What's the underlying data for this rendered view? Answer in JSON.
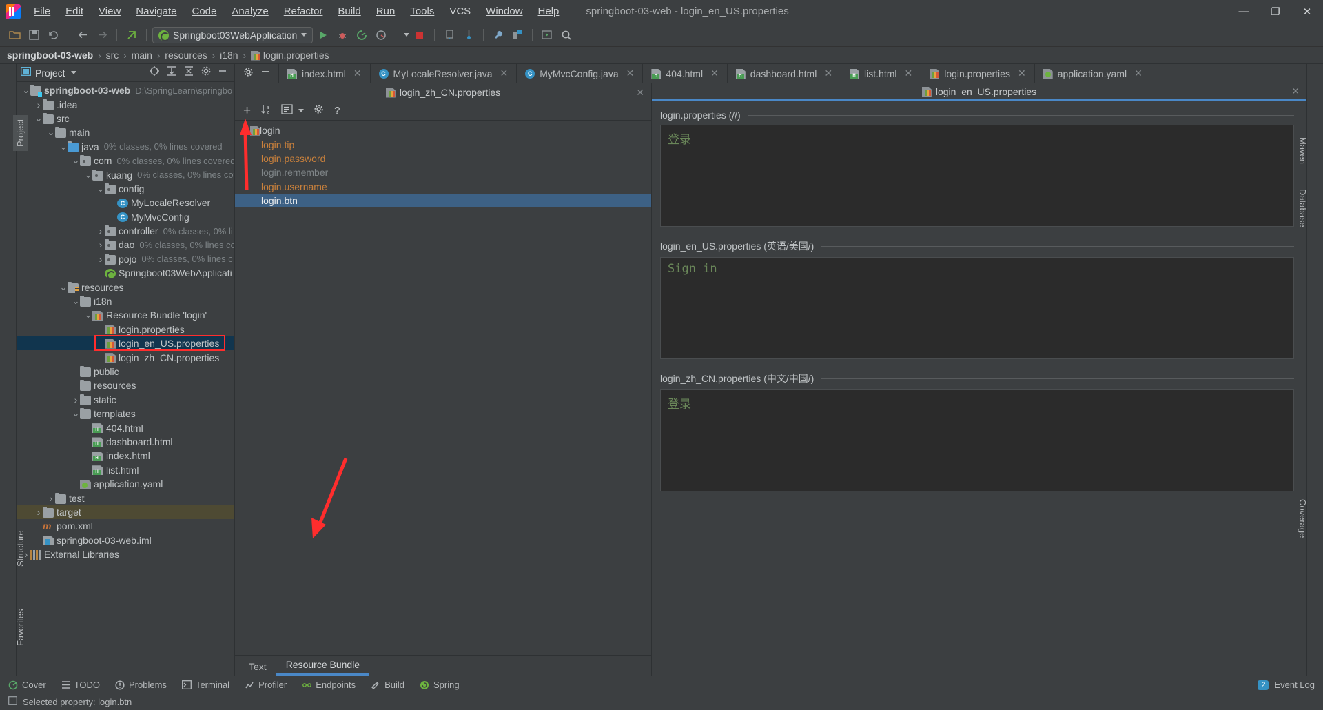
{
  "window": {
    "title": "springboot-03-web - login_en_US.properties",
    "minimize": "—",
    "maximize": "❐",
    "close": "✕"
  },
  "menubar": [
    {
      "label": "File"
    },
    {
      "label": "Edit"
    },
    {
      "label": "View"
    },
    {
      "label": "Navigate"
    },
    {
      "label": "Code"
    },
    {
      "label": "Analyze"
    },
    {
      "label": "Refactor"
    },
    {
      "label": "Build"
    },
    {
      "label": "Run"
    },
    {
      "label": "Tools"
    },
    {
      "label": "VCS"
    },
    {
      "label": "Window"
    },
    {
      "label": "Help"
    }
  ],
  "toolbar": {
    "run_configuration": "Springboot03WebApplication"
  },
  "breadcrumb": {
    "items": [
      "springboot-03-web",
      "src",
      "main",
      "resources",
      "i18n",
      "login.properties"
    ],
    "separator": "›"
  },
  "left_rail": [
    {
      "label": "Project",
      "active": true
    },
    {
      "label": "Structure",
      "active": false
    },
    {
      "label": "Favorites",
      "active": false
    }
  ],
  "right_rail": [
    {
      "label": "Maven",
      "active": false
    },
    {
      "label": "Database",
      "active": false
    },
    {
      "label": "Coverage",
      "active": false
    }
  ],
  "project_panel": {
    "title": "Project",
    "tree": [
      {
        "indent": 0,
        "arrow": "v",
        "icon": "module-folder-icon",
        "label": "springboot-03-web",
        "bold": true,
        "dim": "D:\\SpringLearn\\springbo",
        "state": "none"
      },
      {
        "indent": 1,
        "arrow": ">",
        "icon": "folder-icon",
        "label": ".idea",
        "dim": "",
        "state": "none"
      },
      {
        "indent": 1,
        "arrow": "v",
        "icon": "folder-icon",
        "label": "src",
        "dim": "",
        "state": "none"
      },
      {
        "indent": 2,
        "arrow": "v",
        "icon": "folder-icon",
        "label": "main",
        "dim": "",
        "state": "none"
      },
      {
        "indent": 3,
        "arrow": "v",
        "icon": "source-folder-icon",
        "label": "java",
        "dim": "0% classes, 0% lines covered",
        "state": "none"
      },
      {
        "indent": 4,
        "arrow": "v",
        "icon": "package-icon",
        "label": "com",
        "dim": "0% classes, 0% lines covered",
        "state": "none"
      },
      {
        "indent": 5,
        "arrow": "v",
        "icon": "package-icon",
        "label": "kuang",
        "dim": "0% classes, 0% lines cov",
        "state": "none"
      },
      {
        "indent": 6,
        "arrow": "v",
        "icon": "package-icon",
        "label": "config",
        "dim": "",
        "state": "none"
      },
      {
        "indent": 7,
        "arrow": "",
        "icon": "java-class-icon",
        "label": "MyLocaleResolver",
        "dim": "",
        "state": "none"
      },
      {
        "indent": 7,
        "arrow": "",
        "icon": "java-class-icon",
        "label": "MyMvcConfig",
        "dim": "",
        "state": "none"
      },
      {
        "indent": 6,
        "arrow": ">",
        "icon": "package-icon",
        "label": "controller",
        "dim": "0% classes, 0% li",
        "state": "none"
      },
      {
        "indent": 6,
        "arrow": ">",
        "icon": "package-icon",
        "label": "dao",
        "dim": "0% classes, 0% lines co",
        "state": "none"
      },
      {
        "indent": 6,
        "arrow": ">",
        "icon": "package-icon",
        "label": "pojo",
        "dim": "0% classes, 0% lines c",
        "state": "none"
      },
      {
        "indent": 6,
        "arrow": "",
        "icon": "spring-boot-icon",
        "label": "Springboot03WebApplicati",
        "dim": "",
        "state": "none"
      },
      {
        "indent": 3,
        "arrow": "v",
        "icon": "resources-folder-icon",
        "label": "resources",
        "dim": "",
        "state": "none"
      },
      {
        "indent": 4,
        "arrow": "v",
        "icon": "folder-icon",
        "label": "i18n",
        "dim": "",
        "state": "none"
      },
      {
        "indent": 5,
        "arrow": "v",
        "icon": "resource-bundle-icon",
        "label": "Resource Bundle 'login'",
        "dim": "",
        "state": "none"
      },
      {
        "indent": 6,
        "arrow": "",
        "icon": "properties-file-icon",
        "label": "login.properties",
        "dim": "",
        "state": "none"
      },
      {
        "indent": 6,
        "arrow": "",
        "icon": "properties-file-icon",
        "label": "login_en_US.properties",
        "dim": "",
        "state": "selected"
      },
      {
        "indent": 6,
        "arrow": "",
        "icon": "properties-file-icon",
        "label": "login_zh_CN.properties",
        "dim": "",
        "state": "none"
      },
      {
        "indent": 4,
        "arrow": "",
        "icon": "folder-icon",
        "label": "public",
        "dim": "",
        "state": "none"
      },
      {
        "indent": 4,
        "arrow": "",
        "icon": "folder-icon",
        "label": "resources",
        "dim": "",
        "state": "none"
      },
      {
        "indent": 4,
        "arrow": ">",
        "icon": "folder-icon",
        "label": "static",
        "dim": "",
        "state": "none"
      },
      {
        "indent": 4,
        "arrow": "v",
        "icon": "folder-icon",
        "label": "templates",
        "dim": "",
        "state": "none"
      },
      {
        "indent": 5,
        "arrow": "",
        "icon": "html-file-icon",
        "label": "404.html",
        "dim": "",
        "state": "none"
      },
      {
        "indent": 5,
        "arrow": "",
        "icon": "html-file-icon",
        "label": "dashboard.html",
        "dim": "",
        "state": "none"
      },
      {
        "indent": 5,
        "arrow": "",
        "icon": "html-file-icon",
        "label": "index.html",
        "dim": "",
        "state": "none"
      },
      {
        "indent": 5,
        "arrow": "",
        "icon": "html-file-icon",
        "label": "list.html",
        "dim": "",
        "state": "none"
      },
      {
        "indent": 4,
        "arrow": "",
        "icon": "yaml-file-icon",
        "label": "application.yaml",
        "dim": "",
        "state": "none"
      },
      {
        "indent": 2,
        "arrow": ">",
        "icon": "folder-icon",
        "label": "test",
        "dim": "",
        "state": "none"
      },
      {
        "indent": 1,
        "arrow": ">",
        "icon": "folder-icon",
        "label": "target",
        "dim": "",
        "state": "target"
      },
      {
        "indent": 1,
        "arrow": "",
        "icon": "maven-file-icon",
        "label": "pom.xml",
        "dim": "",
        "state": "none"
      },
      {
        "indent": 1,
        "arrow": "",
        "icon": "iml-file-icon",
        "label": "springboot-03-web.iml",
        "dim": "",
        "state": "none"
      },
      {
        "indent": 0,
        "arrow": ">",
        "icon": "library-icon",
        "label": "External Libraries",
        "dim": "",
        "state": "none"
      }
    ]
  },
  "editor_tabs": [
    {
      "label": "index.html",
      "icon": "html-file-icon",
      "active": false
    },
    {
      "label": "MyLocaleResolver.java",
      "icon": "java-class-icon",
      "active": false
    },
    {
      "label": "MyMvcConfig.java",
      "icon": "java-class-icon",
      "active": false
    },
    {
      "label": "404.html",
      "icon": "html-file-icon",
      "active": false
    },
    {
      "label": "dashboard.html",
      "icon": "html-file-icon",
      "active": false
    },
    {
      "label": "list.html",
      "icon": "html-file-icon",
      "active": false
    },
    {
      "label": "login.properties",
      "icon": "properties-file-icon",
      "active": false
    },
    {
      "label": "application.yaml",
      "icon": "yaml-file-icon",
      "active": false
    }
  ],
  "left_editor": {
    "header_title": "login_zh_CN.properties",
    "close": "✕",
    "toolbar": {
      "add": "+",
      "sort": "↓az",
      "group": "▤",
      "dropdown": "▾",
      "settings": "⚙",
      "help": "?"
    },
    "keys": [
      {
        "label": "login",
        "level": 0,
        "style": "white",
        "arrow": "v",
        "icon": "resource-bundle-icon",
        "selected": false
      },
      {
        "label": "login.tip",
        "level": 1,
        "style": "orange",
        "arrow": "",
        "icon": "",
        "selected": false
      },
      {
        "label": "login.password",
        "level": 1,
        "style": "orange",
        "arrow": "",
        "icon": "",
        "selected": false
      },
      {
        "label": "login.remember",
        "level": 1,
        "style": "dim",
        "arrow": "",
        "icon": "",
        "selected": false
      },
      {
        "label": "login.username",
        "level": 1,
        "style": "orange",
        "arrow": "",
        "icon": "",
        "selected": false
      },
      {
        "label": "login.btn",
        "level": 1,
        "style": "orange",
        "arrow": "",
        "icon": "",
        "selected": true
      }
    ],
    "bottom_tabs": [
      {
        "label": "Text",
        "active": false
      },
      {
        "label": "Resource Bundle",
        "active": true
      }
    ]
  },
  "right_editor": {
    "header_title": "login_en_US.properties",
    "close": "✕",
    "groups": [
      {
        "label": "login.properties (//)",
        "value": "登录"
      },
      {
        "label": "login_en_US.properties (英语/美国/)",
        "value": "Sign in"
      },
      {
        "label": "login_zh_CN.properties (中文/中国/)",
        "value": "登录"
      }
    ]
  },
  "bottom_toolwindows": [
    {
      "label": "Cover",
      "icon": "coverage-icon"
    },
    {
      "label": "TODO",
      "icon": "todo-icon"
    },
    {
      "label": "Problems",
      "icon": "problems-icon"
    },
    {
      "label": "Terminal",
      "icon": "terminal-icon"
    },
    {
      "label": "Profiler",
      "icon": "profiler-icon"
    },
    {
      "label": "Endpoints",
      "icon": "endpoints-icon"
    },
    {
      "label": "Build",
      "icon": "build-icon"
    },
    {
      "label": "Spring",
      "icon": "spring-icon"
    }
  ],
  "event_log": {
    "count": "2",
    "label": "Event Log"
  },
  "status_bar": {
    "message": "Selected property: login.btn"
  },
  "colors": {
    "accent_blue": "#4a88c7",
    "selection_blue": "#3d6185",
    "tree_selection": "#11354e",
    "annotation_red": "#ff2d2d",
    "key_orange": "#c8803c",
    "string_green": "#6a8759"
  }
}
